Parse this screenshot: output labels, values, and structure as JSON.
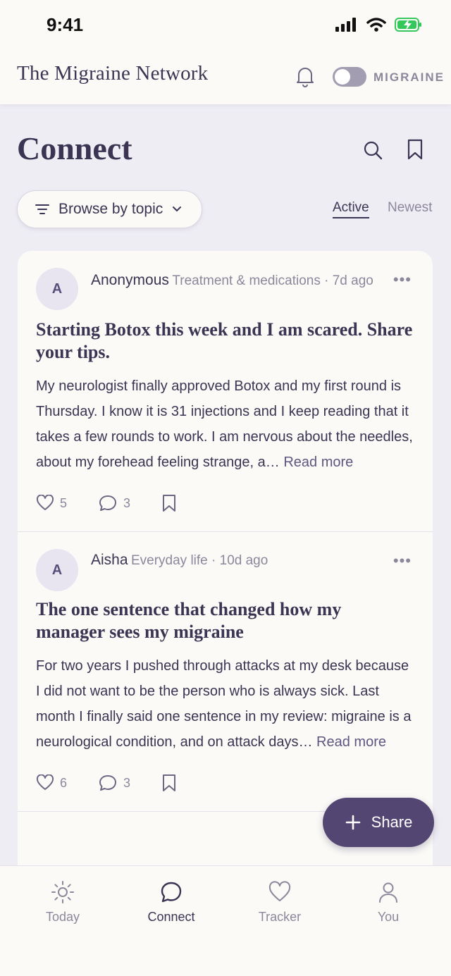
{
  "status": {
    "time": "9:41"
  },
  "header": {
    "brand": "The Migraine Network",
    "mode_label": "MIGRAINE",
    "mode_on": false
  },
  "page": {
    "title": "Connect"
  },
  "filters": {
    "browse_label": "Browse by topic",
    "sort_active": "Active",
    "sort_newest": "Newest"
  },
  "posts": [
    {
      "avatar": "A",
      "author": "Anonymous",
      "meta": "Treatment & medications · 7d ago",
      "title": "Starting Botox this week and I am scared. Share your tips.",
      "body": "My neurologist finally approved Botox and my first round is Thursday. I know it is 31 injections and I keep reading that it takes a few rounds to work. I am nervous about the needles, about my forehead feeling strange, a…",
      "read_more": "Read more",
      "likes": "5",
      "comments": "3"
    },
    {
      "avatar": "A",
      "author": "Aisha",
      "meta": "Everyday life · 10d ago",
      "title": "The one sentence that changed how my manager sees my migraine",
      "body": "For two years I pushed through attacks at my desk because I did not want to be the person who is always sick. Last month I finally said one sentence in my review: migraine is a neurological condition, and on attack days…",
      "read_more": "Read more",
      "likes": "6",
      "comments": "3"
    }
  ],
  "share": {
    "label": "Share"
  },
  "tabs": [
    {
      "label": "Today",
      "icon": "sun-icon"
    },
    {
      "label": "Connect",
      "icon": "chat-bubble-icon"
    },
    {
      "label": "Tracker",
      "icon": "heart-icon"
    },
    {
      "label": "You",
      "icon": "person-icon"
    }
  ],
  "colors": {
    "accent": "#544673",
    "text": "#3b3452",
    "muted": "#8d879c",
    "background": "#efedf4"
  }
}
